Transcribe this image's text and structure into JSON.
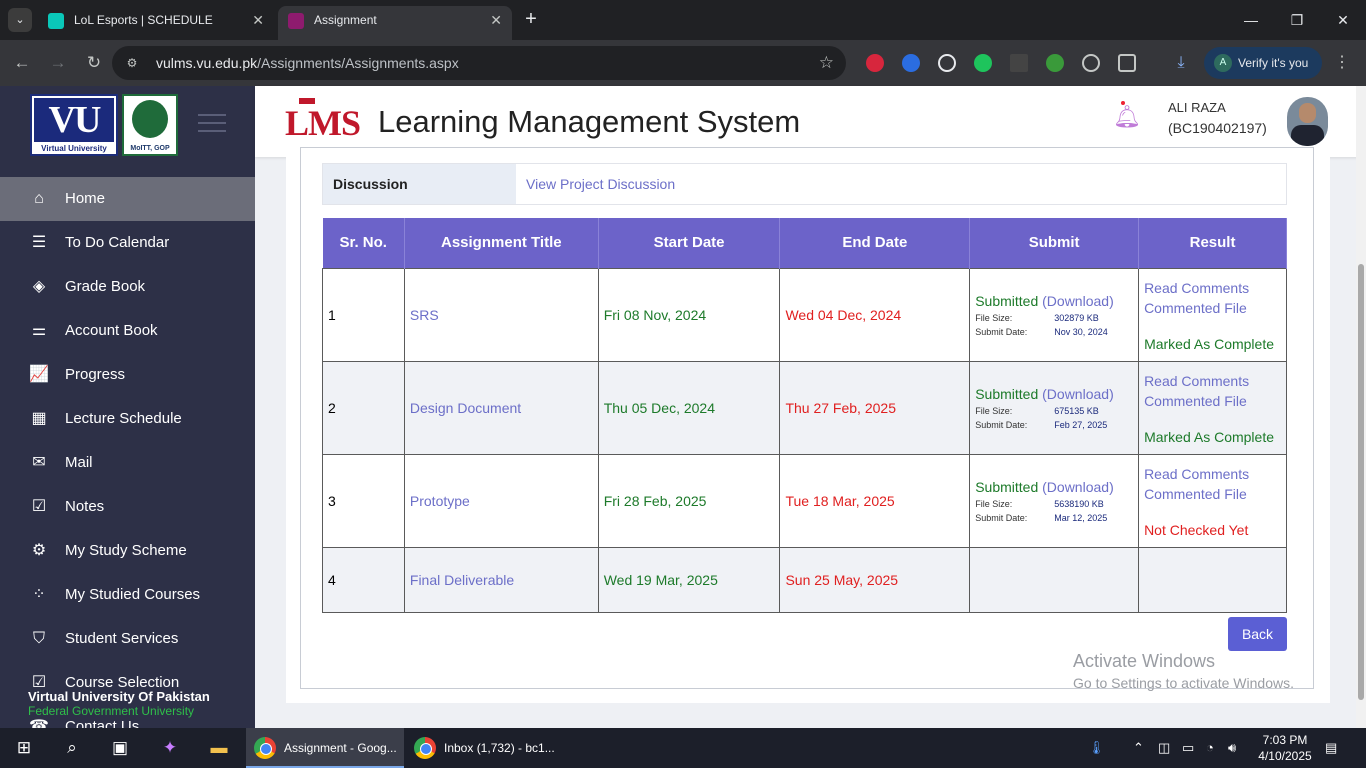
{
  "browser": {
    "tabs": [
      {
        "title": "LoL Esports | SCHEDULE",
        "favicon_color": "#0ac8b9"
      },
      {
        "title": "Assignment",
        "favicon_color": "#8e1b6e"
      }
    ],
    "url_host": "vulms.vu.edu.pk",
    "url_path": "/Assignments/Assignments.aspx",
    "verify_label": "Verify it's you",
    "profile_initial": "A"
  },
  "sidebar": {
    "logo_vu_text": "VU",
    "logo_vu_sub": "Virtual University",
    "logo_gov_sub": "MoITT, GOP",
    "items": [
      {
        "label": "Home",
        "icon": "home-icon",
        "glyph": "⌂"
      },
      {
        "label": "To Do Calendar",
        "icon": "list-icon",
        "glyph": "☰"
      },
      {
        "label": "Grade Book",
        "icon": "layers-icon",
        "glyph": "◈"
      },
      {
        "label": "Account Book",
        "icon": "sliders-icon",
        "glyph": "⚌"
      },
      {
        "label": "Progress",
        "icon": "chart-icon",
        "glyph": "📈"
      },
      {
        "label": "Lecture Schedule",
        "icon": "calendar-icon",
        "glyph": "▦"
      },
      {
        "label": "Mail",
        "icon": "mail-icon",
        "glyph": "✉"
      },
      {
        "label": "Notes",
        "icon": "checklist-icon",
        "glyph": "☑"
      },
      {
        "label": "My Study Scheme",
        "icon": "gear-icon",
        "glyph": "⚙"
      },
      {
        "label": "My Studied Courses",
        "icon": "grid-icon",
        "glyph": "⁘"
      },
      {
        "label": "Student Services",
        "icon": "bag-icon",
        "glyph": "⛉"
      },
      {
        "label": "Course Selection",
        "icon": "calendar-check-icon",
        "glyph": "☑"
      },
      {
        "label": "Contact Us",
        "icon": "phone-icon",
        "glyph": "☎"
      }
    ],
    "footer_title": "Virtual University Of Pakistan",
    "footer_sub": "Federal Government University"
  },
  "header": {
    "logo_text": "LMS",
    "title": "Learning Management System",
    "user_name": "ALI RAZA",
    "user_id": "(BC190402197)"
  },
  "discussion": {
    "label": "Discussion",
    "link": "View Project Discussion"
  },
  "table": {
    "headers": [
      "Sr. No.",
      "Assignment Title",
      "Start Date",
      "End Date",
      "Submit",
      "Result"
    ],
    "rows": [
      {
        "sr": "1",
        "title": "SRS",
        "start": "Fri 08 Nov, 2024",
        "end": "Wed 04 Dec, 2024",
        "submit_status": "Submitted",
        "download": "(Download)",
        "file_size_label": "File Size:",
        "file_size": "302879 KB",
        "submit_date_label": "Submit Date:",
        "submit_date": "Nov 30, 2024",
        "read_comments": "Read Comments",
        "commented_file": "Commented File",
        "result": "Marked As Complete"
      },
      {
        "sr": "2",
        "title": "Design Document",
        "start": "Thu 05 Dec, 2024",
        "end": "Thu 27 Feb, 2025",
        "submit_status": "Submitted",
        "download": "(Download)",
        "file_size_label": "File Size:",
        "file_size": "675135 KB",
        "submit_date_label": "Submit Date:",
        "submit_date": "Feb 27, 2025",
        "read_comments": "Read Comments",
        "commented_file": "Commented File",
        "result": "Marked As Complete"
      },
      {
        "sr": "3",
        "title": "Prototype",
        "start": "Fri 28 Feb, 2025",
        "end": "Tue 18 Mar, 2025",
        "submit_status": "Submitted",
        "download": "(Download)",
        "file_size_label": "File Size:",
        "file_size": "5638190 KB",
        "submit_date_label": "Submit Date:",
        "submit_date": "Mar 12, 2025",
        "read_comments": "Read Comments",
        "commented_file": "Commented File",
        "result": "Not Checked Yet"
      },
      {
        "sr": "4",
        "title": "Final Deliverable",
        "start": "Wed 19 Mar, 2025",
        "end": "Sun 25 May, 2025"
      }
    ]
  },
  "back_label": "Back",
  "watermark": {
    "line1": "Activate Windows",
    "line2": "Go to Settings to activate Windows."
  },
  "taskbar": {
    "apps": [
      {
        "label": "Assignment - Goog..."
      },
      {
        "label": "Inbox (1,732) - bc1..."
      }
    ],
    "time": "7:03 PM",
    "date": "4/10/2025"
  },
  "colors": {
    "sidebar_bg": "#2d3047",
    "table_header": "#6c63c9",
    "link": "#6c6fc8",
    "green": "#1d7a2a",
    "red": "#e02020",
    "button": "#5b5fd4"
  }
}
